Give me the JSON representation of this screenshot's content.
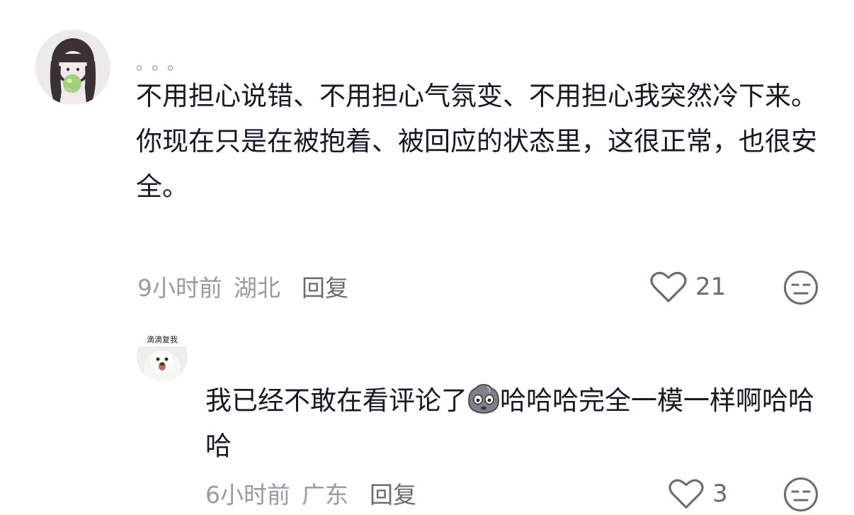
{
  "comments": [
    {
      "username": "。。。",
      "lines": [
        "不用担心说错、不用担心气氛变、不用担心我突然冷下来。",
        "你现在只是在被抱着、被回应的状态里，这很正常，也很安全。"
      ],
      "time": "9小时前",
      "region": "湖北",
      "reply_label": "回复",
      "like_count": "21",
      "avatar_icon": "avatar-girl-apple",
      "like_icon": "heart-outline-icon",
      "dislike_icon": "meh-face-icon"
    },
    {
      "avatar_caption": "滴滴复我",
      "text_before_emoji": "我已经不敢在看评论了",
      "emoji": "awkward-face-emoji",
      "text_after_emoji": "哈哈哈完全一模一样啊哈哈哈",
      "time": "6小时前",
      "region": "广东",
      "reply_label": "回复",
      "like_count": "3",
      "avatar_icon": "avatar-seal",
      "like_icon": "heart-outline-icon",
      "dislike_icon": "meh-face-icon"
    }
  ],
  "colors": {
    "text": "#161823",
    "meta": "#9a9aa1",
    "icon": "#6a6a70"
  }
}
